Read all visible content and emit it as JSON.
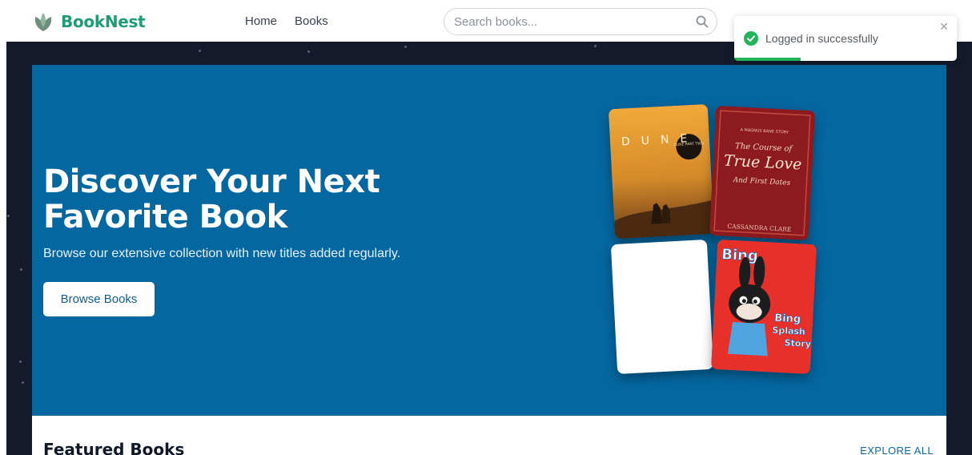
{
  "brand": {
    "name": "BookNest",
    "color": "#1f9c77"
  },
  "nav": {
    "links": [
      {
        "label": "Home"
      },
      {
        "label": "Books"
      }
    ]
  },
  "search": {
    "placeholder": "Search books...",
    "icon": "search-icon"
  },
  "hero": {
    "title": "Discover Your Next Favorite Book",
    "subtitle": "Browse our extensive collection with new titles added regularly.",
    "button_label": "Browse Books",
    "background": "#0567a0",
    "covers": [
      {
        "title": "DUNE",
        "badge": "DUNE PART TWO"
      },
      {
        "series": "A MAGNUS BANE STORY",
        "title_top": "The Course of",
        "title_main": "True Love",
        "title_sub": "And First Dates",
        "author": "CASSANDRA CLARE"
      },
      {
        "title": ""
      },
      {
        "logo": "Bing",
        "title_1": "Bing",
        "title_2": "Splash",
        "title_3": "Story"
      }
    ]
  },
  "featured": {
    "title": "Featured Books",
    "explore_label": "EXPLORE ALL"
  },
  "toast": {
    "message": "Logged in successfully",
    "close_symbol": "✕",
    "progress": 0.3,
    "color": "#21b45a"
  }
}
